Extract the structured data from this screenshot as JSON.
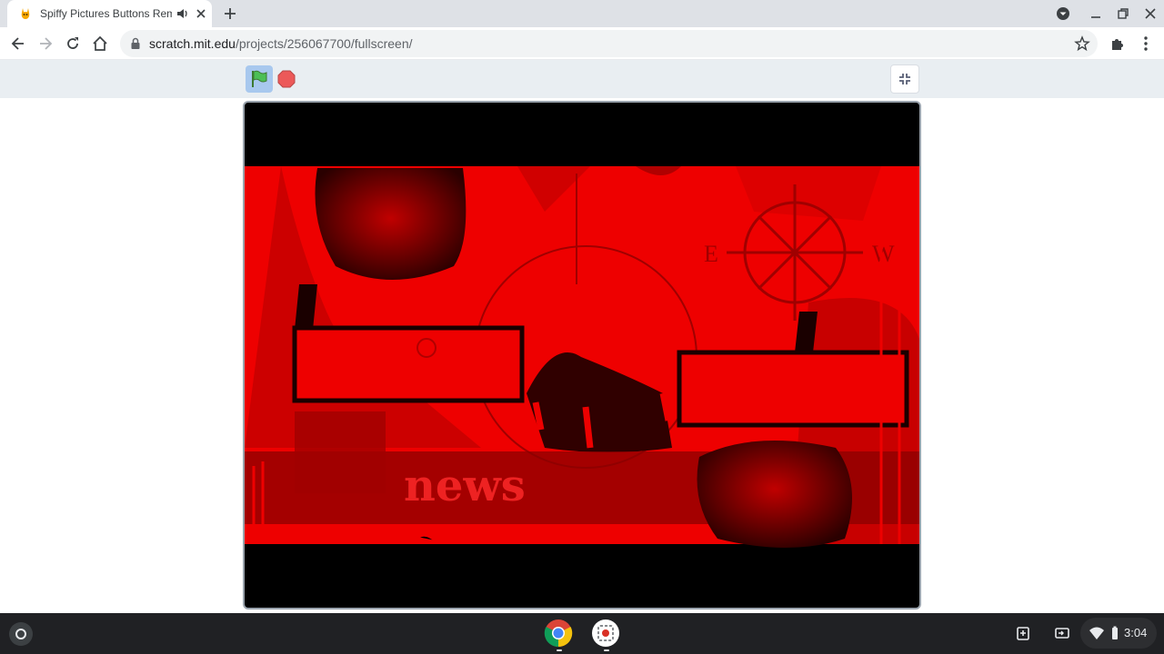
{
  "browser": {
    "tab": {
      "title": "Spiffy Pictures Buttons Rem",
      "favicon": "scratch-cat-icon",
      "audio_icon": "speaker-icon",
      "close_icon": "close-icon"
    },
    "new_tab_icon": "plus-icon",
    "window_controls": [
      "profile-menu-icon",
      "minimize-icon",
      "restore-icon",
      "close-icon"
    ],
    "nav": [
      "back-icon",
      "forward-icon",
      "reload-icon",
      "home-icon"
    ],
    "url_host": "scratch.mit.edu",
    "url_path": "/projects/256067700/fullscreen/",
    "toolbar_icons": [
      "star-icon",
      "extensions-icon",
      "menu-icon"
    ]
  },
  "player": {
    "green_flag": "green-flag-icon",
    "stop": "stop-icon",
    "exit_fullscreen": "exit-fullscreen-icon"
  },
  "stage": {
    "headline_text": "news",
    "compass_letters": [
      "E",
      "W"
    ],
    "colors": {
      "red": "#ff0000",
      "dark_red": "#8b0000",
      "black": "#000000"
    }
  },
  "shelf": {
    "apps": [
      "chrome-icon",
      "screen-capture-icon"
    ],
    "clock": "3:04",
    "colors": {
      "shelf": "#202124"
    }
  }
}
